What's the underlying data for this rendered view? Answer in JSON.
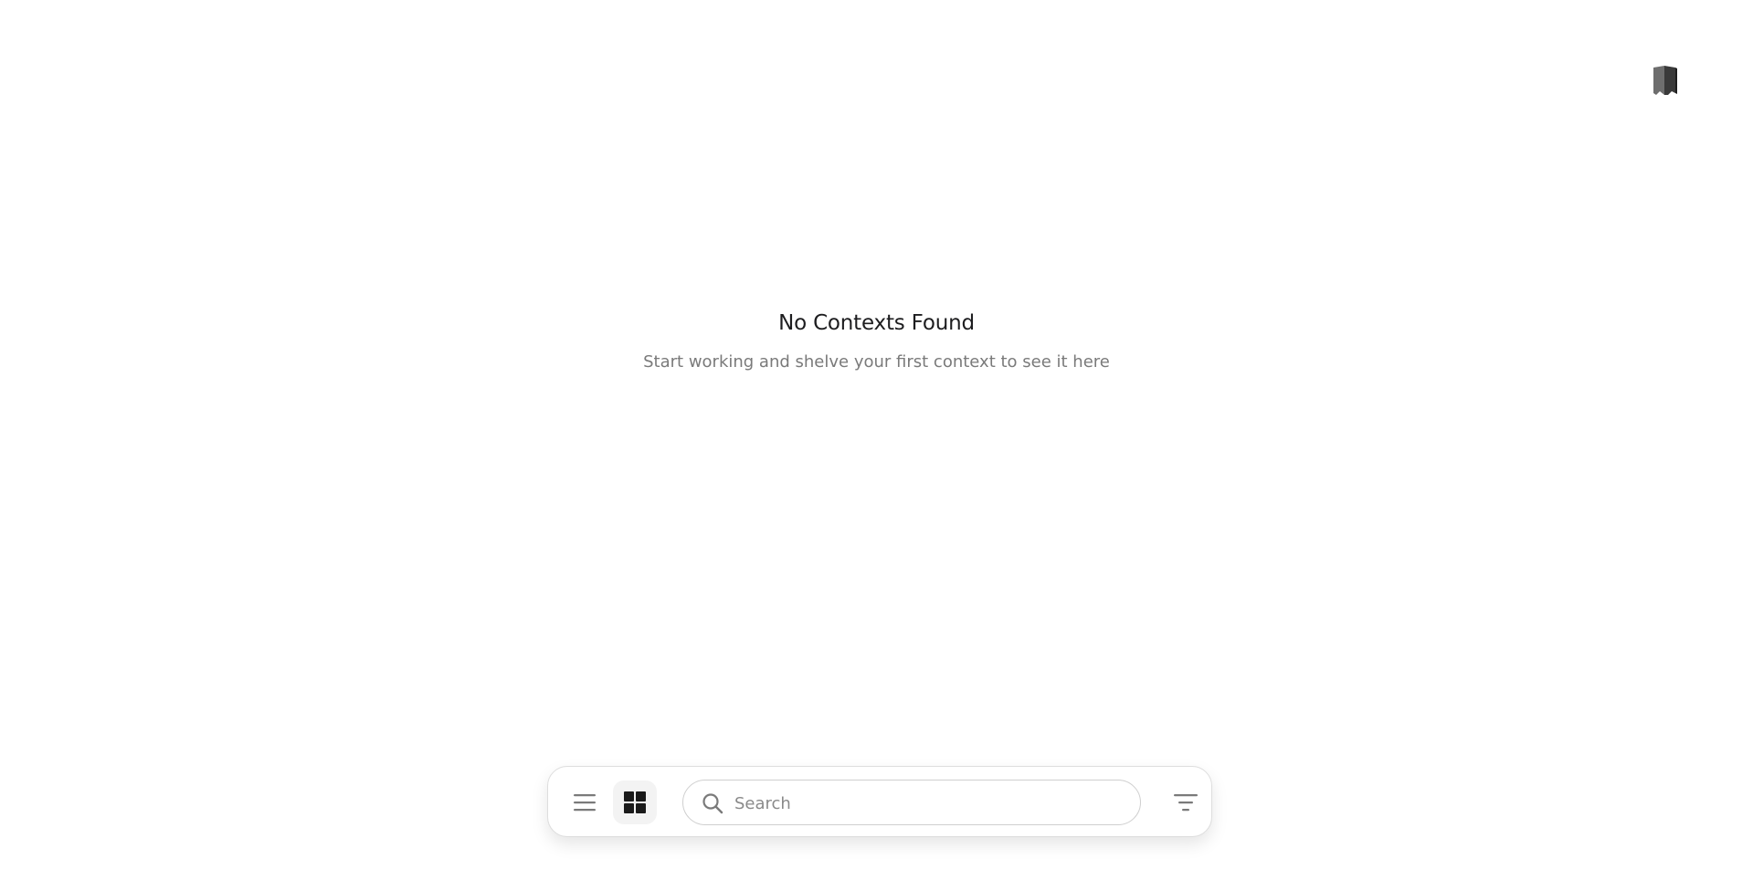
{
  "header": {
    "logo_icon": "shelf-books-icon"
  },
  "empty_state": {
    "title": "No Contexts Found",
    "subtitle": "Start working and shelve your first context to see it here"
  },
  "toolbar": {
    "list_view_icon": "list-icon",
    "grid_view_icon": "grid-icon",
    "active_view": "grid",
    "search": {
      "placeholder": "Search",
      "value": ""
    },
    "filter_icon": "filter-icon"
  },
  "colors": {
    "text_primary": "#1d1d1f",
    "text_secondary": "#7a7a7a",
    "icon_gray": "#7a7a7a",
    "icon_dark": "#1a1a1a",
    "border": "#dddddd"
  }
}
